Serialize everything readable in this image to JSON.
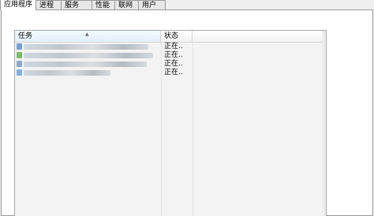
{
  "tabs": [
    {
      "label": "应用程序",
      "active": true
    },
    {
      "label": "进程",
      "active": false
    },
    {
      "label": "服务",
      "active": false
    },
    {
      "label": "性能",
      "active": false
    },
    {
      "label": "联网",
      "active": false
    },
    {
      "label": "用户",
      "active": false
    }
  ],
  "list": {
    "columns": {
      "task": "任务",
      "status": "状态"
    },
    "sort_icon": "sort-ascending-icon",
    "rows": [
      {
        "status": "正在..",
        "icon_color": "#7a9fd0"
      },
      {
        "status": "正在..",
        "icon_color": "#7fb86a"
      },
      {
        "status": "正在..",
        "icon_color": "#8fa8c8"
      },
      {
        "status": "正在..",
        "icon_color": "#86b0d8"
      }
    ]
  },
  "highlight_color": "#b057c8"
}
